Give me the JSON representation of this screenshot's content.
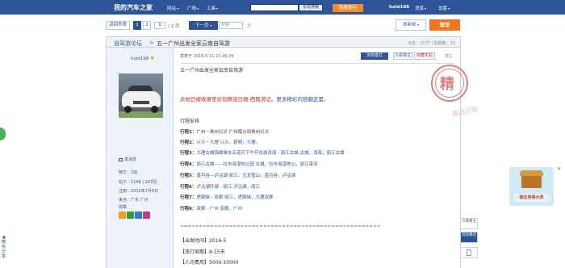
{
  "header": {
    "brand": "我的汽车之家",
    "nav": [
      {
        "label": "网站",
        "arrow": "▾"
      },
      {
        "label": "广场",
        "arrow": "▾"
      },
      {
        "label": "工具",
        "arrow": "▾"
      }
    ],
    "search_button": "论坛搜索",
    "ask_button": "我要提问",
    "username": "hold168",
    "messages": "消息",
    "settings": "设置",
    "dropdown_arrow": "▾"
  },
  "pager": {
    "back": "返回列表",
    "pages": [
      "1",
      "2"
    ],
    "page_input": "1",
    "total": "/ 2 页",
    "next": "下一页",
    "goto_placeholder": "到第",
    "goto_suffix": "页",
    "post_button": "发新帖",
    "reply_button": "填写"
  },
  "thread": {
    "forum": "自驾游论坛",
    "separator": ">",
    "title": "五一广州出发全家云南自驾游",
    "stats": "点击：2177 | 回复数：25"
  },
  "author": {
    "name": "hold168",
    "send_pm": "发消息",
    "stats": [
      {
        "label": "精华：",
        "value": "1帖"
      },
      {
        "label": "帖子：",
        "value": "1148 | 247回"
      },
      {
        "label": "注册：",
        "value": "2012年7月8日"
      },
      {
        "label": "来自：",
        "value": "广东 广州"
      }
    ],
    "badges_label": "勋章",
    "medal_colors": [
      "#f0a020",
      "#3a9b3a",
      "#2d7fd0",
      "#c43a8a"
    ]
  },
  "post": {
    "posted_label": "发表于",
    "posted_at": "2016-5-11 22:46:39",
    "btn_browse": "浏览模式",
    "btn_author_only": "只看楼主",
    "btn_collect": "收藏本帖",
    "floor": "楼主",
    "content_head": "五一广州出发全家云南自驾游",
    "notice_prefix": "此帖已被收录至论坛精选日报-西南游记。",
    "notice_link": "更多精彩内容翻这里",
    "notice_suffix": "。",
    "section_title": "行程安排",
    "days": [
      {
        "day": "行程1：",
        "text": "广州－贵州兴义  广州南沙到贵州兴义"
      },
      {
        "day": "行程2：",
        "text": "兴义－大理  兴义，昆明，大理。"
      },
      {
        "day": "行程3：",
        "text": "大理古城锦绣单车五道河下午开车游洱海 - 丽江古城  古城，洱海，丽江古城"
      },
      {
        "day": "行程4：",
        "text": "丽江古城——拉市海湿地公园  古城，拉市海湿地公，丽江束河"
      },
      {
        "day": "行程5：",
        "text": "蓝月谷—泸沽湖  丽江，玉龙雪山，蓝月谷，泸沽湖"
      },
      {
        "day": "行程6：",
        "text": "泸沽湖环湖 - 丽江  泸沽湖，丽江"
      },
      {
        "day": "行程7：",
        "text": "虎跳峡 - 双廊  丽江，虎跳峡，大理双廊"
      },
      {
        "day": "行程8：",
        "text": "双廊 - 广州  双廊，广州"
      }
    ],
    "dashes": "=====================================================",
    "info": [
      "【出发时间】2016-5",
      "【旅行周期】8-15天",
      "【人均费用】5000-10000"
    ]
  },
  "stamp": {
    "char": "精",
    "sub": "精选日报"
  },
  "side_tools": [
    "只看楼主",
    "浏览模式"
  ],
  "ad": {
    "text": "做任务得大奖",
    "close": "✕"
  },
  "left_tab": "微信分享",
  "colors": {
    "header": "#2d5496",
    "orange": "#f27621",
    "red": "#d0221b"
  }
}
